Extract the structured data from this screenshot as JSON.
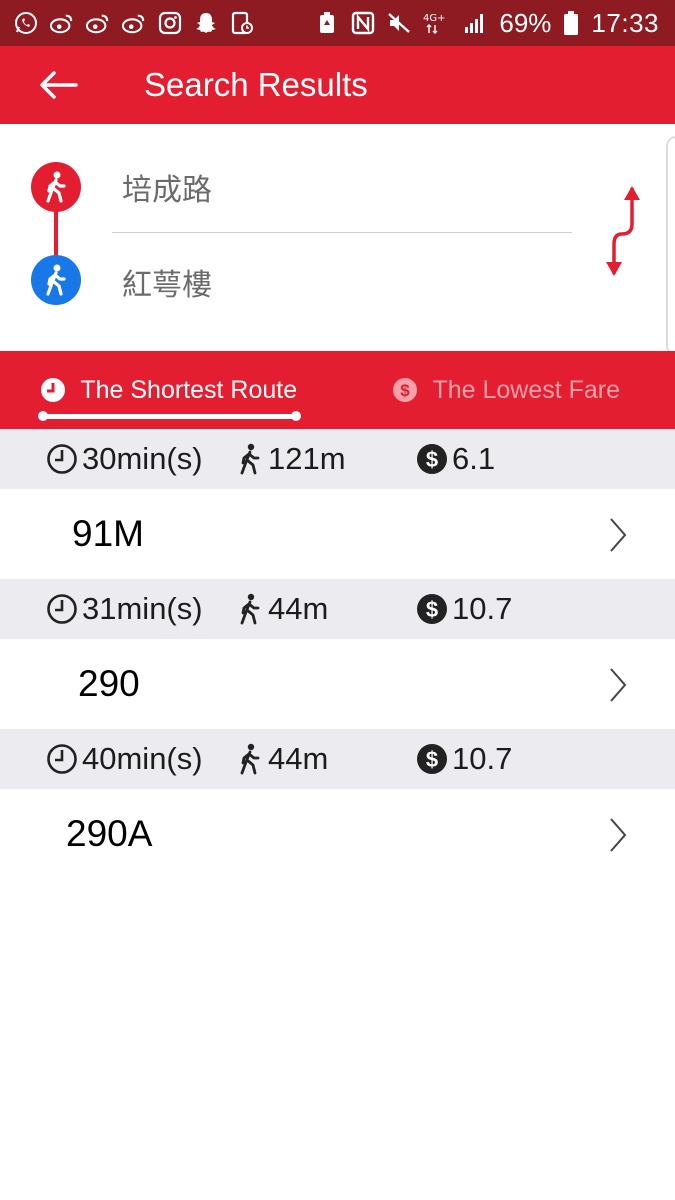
{
  "status_bar": {
    "battery_percent": "69%",
    "time": "17:33",
    "network": "4G+",
    "icons": [
      "whatsapp-icon",
      "weibo-icon",
      "weibo-icon",
      "weibo-icon",
      "instagram-icon",
      "snapchat-icon",
      "app-icon",
      "battery-saver-icon",
      "nfc-icon",
      "mute-icon",
      "signal-icon",
      "battery-icon"
    ]
  },
  "app_bar": {
    "title": "Search Results",
    "back_icon": "arrow-left-icon"
  },
  "search": {
    "origin": "培成路",
    "destination": "紅萼樓",
    "swap_icon": "swap-icon"
  },
  "tabs": [
    {
      "label": "The Shortest Route",
      "icon": "clock-icon",
      "active": true
    },
    {
      "label": "The Lowest Fare",
      "icon": "dollar-icon",
      "active": false
    }
  ],
  "routes": [
    {
      "duration": "30min(s)",
      "walk": "121m",
      "fare": "6.1",
      "name": "91M"
    },
    {
      "duration": "31min(s)",
      "walk": "44m",
      "fare": "10.7",
      "name": "290"
    },
    {
      "duration": "40min(s)",
      "walk": "44m",
      "fare": "10.7",
      "name": "290A"
    }
  ],
  "colors": {
    "status_bar": "#8e1a22",
    "brand_red": "#e31e31",
    "destination_blue": "#1878e8",
    "meta_background": "#ececf0"
  }
}
